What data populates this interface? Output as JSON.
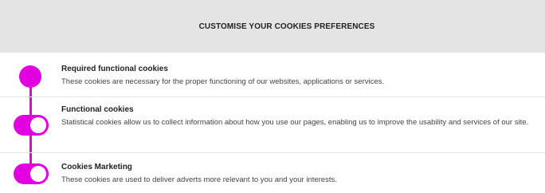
{
  "colors": {
    "accent": "#e000e0",
    "header_bg": "#e4e4e4"
  },
  "header": {
    "title": "CUSTOMISE YOUR COOKIES PREFERENCES"
  },
  "preferences": [
    {
      "title": "Required functional cookies",
      "description": "These cookies are necessary for the proper functioning of our websites, applications or services.",
      "control": "required",
      "enabled": true
    },
    {
      "title": "Functional cookies",
      "description": "Statistical cookies allow us to collect information about how you use our pages, enabling us to improve the usability and services of our site.",
      "control": "toggle",
      "enabled": true
    },
    {
      "title": "Cookies Marketing",
      "description": "These cookies are used to deliver adverts more relevant to you and your interests.",
      "control": "toggle",
      "enabled": true
    }
  ]
}
